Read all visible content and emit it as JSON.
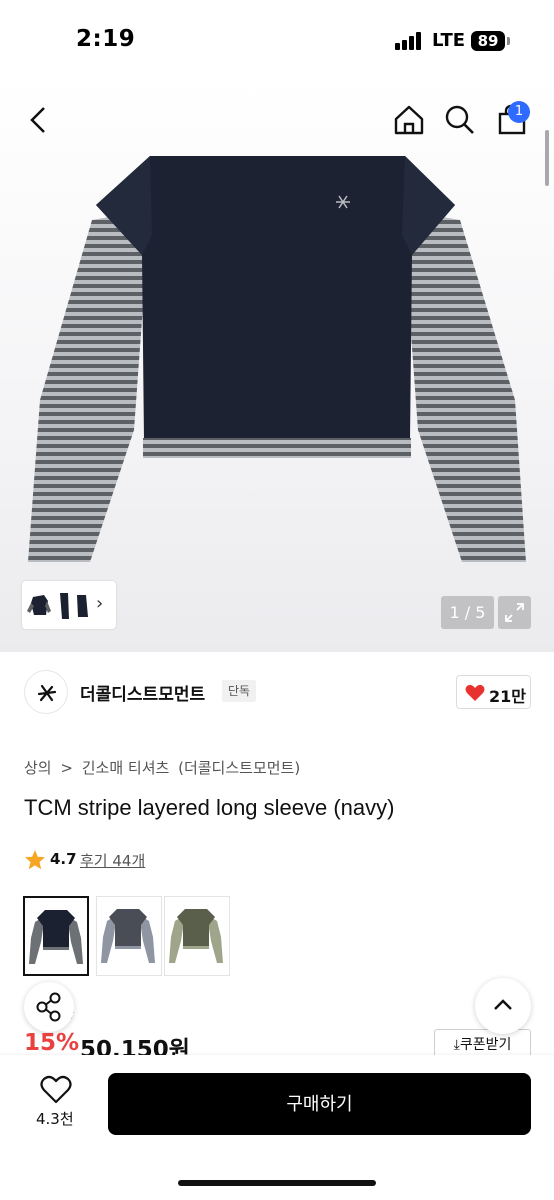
{
  "status_bar": {
    "time": "2:19",
    "network": "LTE",
    "battery": "89"
  },
  "header": {
    "cart_count": "1"
  },
  "gallery": {
    "page_indicator": "1 / 5"
  },
  "brand": {
    "name": "더콜디스트모먼트",
    "tag": "단독",
    "like_count": "21만"
  },
  "breadcrumb": {
    "items": [
      "상의",
      ">",
      "긴소매 티셔츠",
      "(더콜디스트모먼트)"
    ]
  },
  "product": {
    "title": "TCM stripe layered long sleeve (navy)",
    "rating": "4.7",
    "review_label": "후기 44개",
    "color_variants": [
      {
        "name": "navy",
        "body_color": "#1b2130",
        "sleeve_color": "#6c7176",
        "selected": true
      },
      {
        "name": "charcoal",
        "body_color": "#4a4d55",
        "sleeve_color": "#8f95a3",
        "selected": false
      },
      {
        "name": "khaki",
        "body_color": "#5a5f4c",
        "sleeve_color": "#9ea58a",
        "selected": false
      }
    ]
  },
  "price": {
    "original_price": "원",
    "discount": "15%",
    "sale_price": "50,150원",
    "coupon_label": "쿠폰받기"
  },
  "bottom_bar": {
    "wish_count": "4.3천",
    "buy_label": "구매하기"
  },
  "colors": {
    "accent_blue": "#2f6bff",
    "discount_red": "#e8413f",
    "heart_red": "#e8322f",
    "rating_star": "#f5a623"
  }
}
